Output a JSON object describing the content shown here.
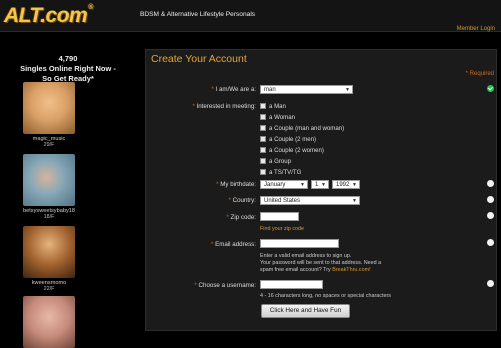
{
  "header": {
    "logo_text": "ALT.com",
    "logo_reg": "®",
    "tagline": "BDSM & Alternative Lifestyle Personals",
    "member_login": "Member Login"
  },
  "sidebar": {
    "online_count": "4,790",
    "online_text_line1": "Singles Online Right Now -",
    "online_text_line2": "So Get Ready*",
    "profiles": [
      {
        "name": "magic_music",
        "meta": "29/F",
        "color": "#d9a066"
      },
      {
        "name": "betsysweetsybaby18",
        "meta": "18/F",
        "color": "#6a9bb0"
      },
      {
        "name": "kweensmomo",
        "meta": "22/F",
        "color": "#a0612e"
      },
      {
        "name": "",
        "meta": "",
        "color": "#c58a7a"
      }
    ]
  },
  "form": {
    "heading": "Create Your Account",
    "required_note": "* Required",
    "iam_label": "I am/We are a:",
    "iam_value": "man",
    "interested_label": "Interested in meeting:",
    "interested_options": [
      "a Man",
      "a Woman",
      "a Couple (man and woman)",
      "a Couple (2 men)",
      "a Couple (2 women)",
      "a Group",
      "a TS/TV/TG"
    ],
    "birthdate_label": "My birthdate:",
    "birth_month": "January",
    "birth_day": "1",
    "birth_year": "1992",
    "country_label": "Country:",
    "country_value": "United States",
    "zip_label": "Zip code:",
    "zip_help": "Find your zip code",
    "email_label": "Email address:",
    "email_help_1": "Enter a valid email address to sign up.",
    "email_help_2": "Your password will be sent to that address. Need a",
    "email_help_3": "spam free email account? Try ",
    "email_help_link": "BreakThru.com!",
    "username_label": "Choose a username:",
    "username_help": "4 - 16 characters long, no spaces or special characters",
    "submit_label": "Click Here and Have Fun"
  },
  "colors": {
    "accent": "#e0a53a",
    "required": "#d06b1e",
    "status_ok": "#27c24a"
  }
}
